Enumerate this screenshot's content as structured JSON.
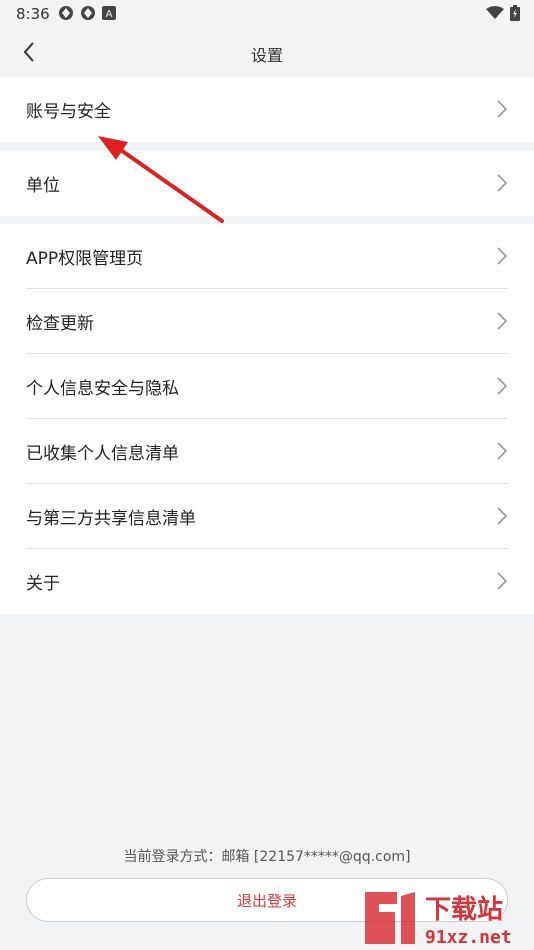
{
  "status_bar": {
    "time": "8:36",
    "left_icons": [
      "app-icon-1",
      "app-icon-2",
      "a-icon"
    ],
    "right_icons": [
      "wifi-icon",
      "battery-icon"
    ]
  },
  "header": {
    "back_icon": "back-chevron-icon",
    "title": "设置"
  },
  "groups": [
    {
      "items": [
        {
          "label": "账号与安全"
        }
      ]
    },
    {
      "items": [
        {
          "label": "单位"
        }
      ]
    },
    {
      "items": [
        {
          "label": "APP权限管理页"
        },
        {
          "label": "检查更新"
        },
        {
          "label": "个人信息安全与隐私"
        },
        {
          "label": "已收集个人信息清单"
        },
        {
          "label": "与第三方共享信息清单"
        },
        {
          "label": "关于"
        }
      ]
    }
  ],
  "footer": {
    "login_info": "当前登录方式：邮箱 [22157*****@qq.com]",
    "logout_label": "退出登录"
  },
  "watermark": {
    "text_top": "下载站",
    "text_bottom": "91xz.net"
  },
  "colors": {
    "background": "#f2f3f5",
    "card": "#ffffff",
    "logout_text": "#e53935",
    "annotation_arrow": "#e02020",
    "watermark": "#d8333a"
  }
}
